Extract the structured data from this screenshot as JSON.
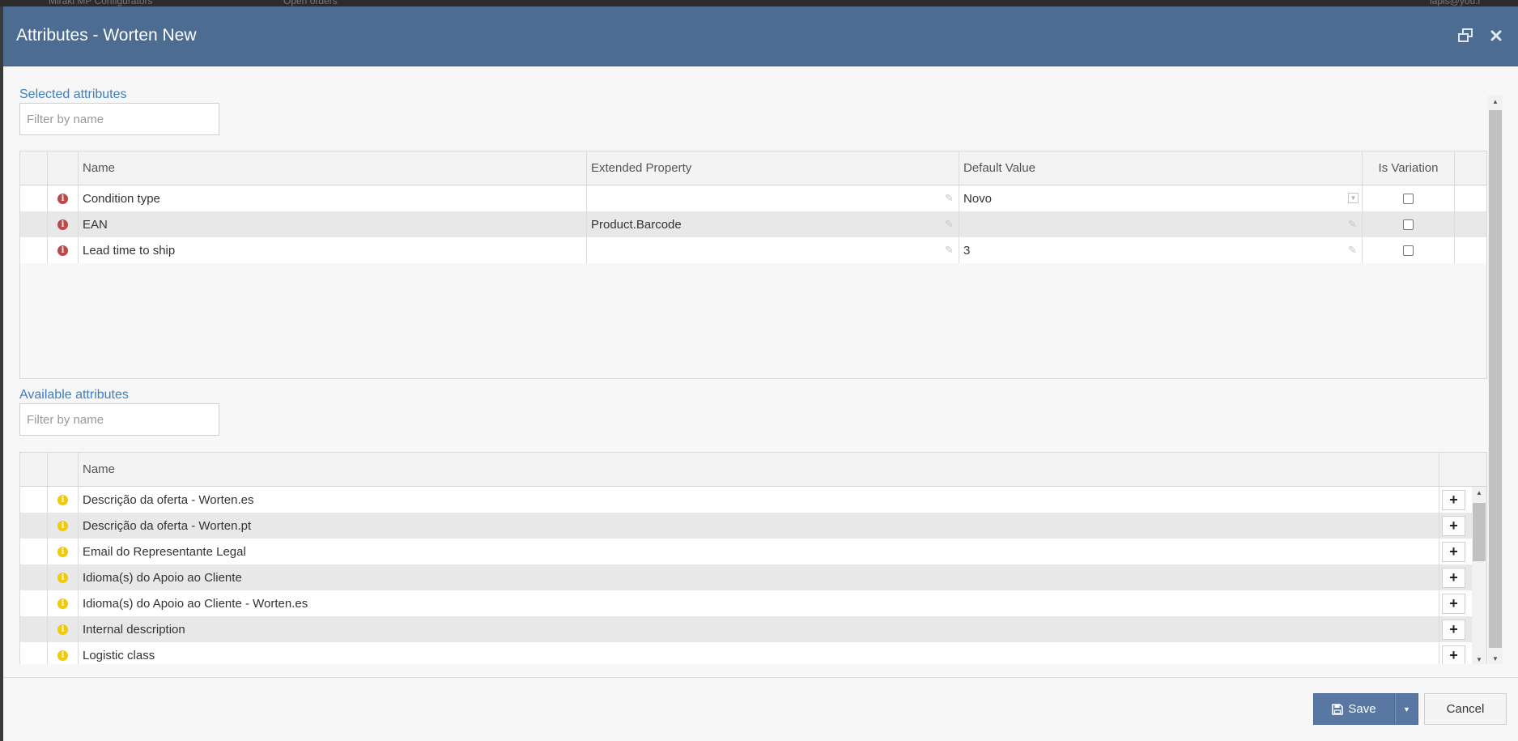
{
  "background": {
    "tab1": "Mirakl MP Configurators",
    "tab2": "Open orders",
    "user": "lapis@you.l"
  },
  "dialog": {
    "title": "Attributes - Worten New"
  },
  "selected": {
    "label": "Selected attributes",
    "filter_placeholder": "Filter by name",
    "columns": {
      "name": "Name",
      "extended_property": "Extended Property",
      "default_value": "Default Value",
      "is_variation": "Is Variation"
    },
    "rows": [
      {
        "name": "Condition type",
        "extended_property": "",
        "default_value": "Novo",
        "is_variation": false
      },
      {
        "name": "EAN",
        "extended_property": "Product.Barcode",
        "default_value": "",
        "is_variation": false
      },
      {
        "name": "Lead time to ship",
        "extended_property": "",
        "default_value": "3",
        "is_variation": false
      }
    ]
  },
  "available": {
    "label": "Available attributes",
    "filter_placeholder": "Filter by name",
    "columns": {
      "name": "Name"
    },
    "rows": [
      {
        "name": "Descrição da oferta - Worten.es"
      },
      {
        "name": "Descrição da oferta - Worten.pt"
      },
      {
        "name": "Email do Representante Legal"
      },
      {
        "name": "Idioma(s) do Apoio ao Cliente"
      },
      {
        "name": "Idioma(s) do Apoio ao Cliente - Worten.es"
      },
      {
        "name": "Internal description"
      },
      {
        "name": "Logistic class"
      }
    ]
  },
  "footer": {
    "save_label": "Save",
    "cancel_label": "Cancel"
  },
  "colors": {
    "titlebar": "#4c6d91",
    "accent_label": "#3d7ebf",
    "save_button": "#5878a3",
    "info_red": "#b94a48",
    "info_yellow": "#f2c80f"
  },
  "icons": {
    "restore": "restore-window-icon",
    "close": "close-icon",
    "info": "info-icon",
    "edit": "edit-icon",
    "dropdown": "dropdown-icon",
    "add": "plus-icon",
    "save": "floppy-disk-icon",
    "caret": "caret-down-icon"
  }
}
